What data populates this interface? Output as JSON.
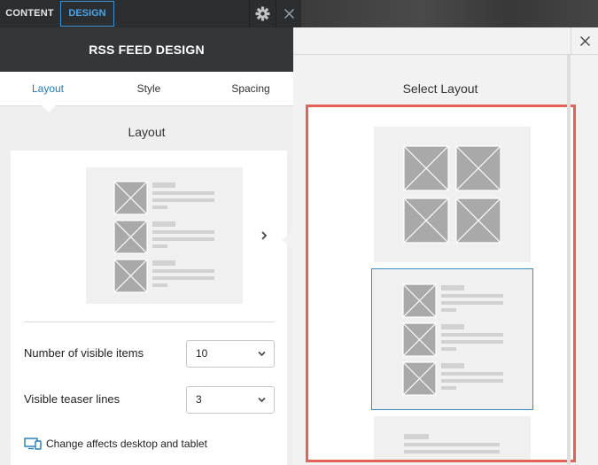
{
  "topbar": {
    "tabs": [
      {
        "label": "CONTENT",
        "active": false
      },
      {
        "label": "DESIGN",
        "active": true
      }
    ],
    "icons": [
      "gear-icon",
      "close-icon"
    ]
  },
  "panel": {
    "title": "RSS FEED DESIGN",
    "subtabs": [
      {
        "label": "Layout",
        "active": true
      },
      {
        "label": "Style",
        "active": false
      },
      {
        "label": "Spacing",
        "active": false
      }
    ],
    "section_title": "Layout",
    "fields": {
      "visible_items": {
        "label": "Number of visible items",
        "value": "10"
      },
      "teaser_lines": {
        "label": "Visible teaser lines",
        "value": "3"
      }
    },
    "note": "Change affects desktop and tablet"
  },
  "select_layout": {
    "title": "Select Layout",
    "options": [
      "grid-2x2",
      "list-thumbnails",
      "list-text"
    ],
    "selected_index": 1
  },
  "colors": {
    "accent": "#1e7ab8",
    "highlight_border": "#e36357",
    "dark_header": "#33373a",
    "placeholder": "#a9a9a9"
  }
}
